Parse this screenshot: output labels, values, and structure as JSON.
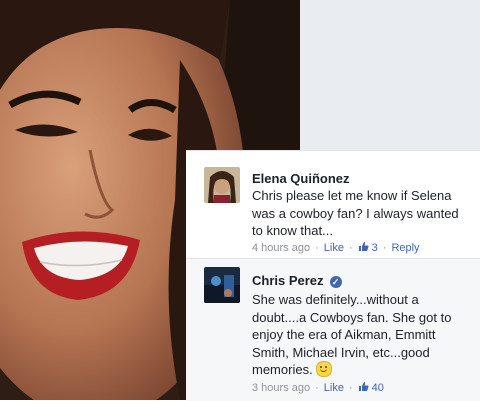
{
  "comments": [
    {
      "author": "Elena Quiñonez",
      "text": "Chris please let me know if Selena was a cowboy fan? I always wanted to know that...",
      "time": "4 hours ago",
      "like_label": "Like",
      "like_count": "3",
      "reply_label": "Reply",
      "verified": false
    },
    {
      "author": "Chris Perez",
      "text": "She was definitely...without a doubt....a Cowboys fan. She got to enjoy the era of Aikman, Emmitt Smith, Michael Irvin, etc...good memories.",
      "time": "3 hours ago",
      "like_label": "Like",
      "like_count": "40",
      "verified": true
    }
  ],
  "icons": {
    "verified": "verified-badge-icon",
    "thumb": "thumbs-up-icon",
    "emoji": "smile-emoji-icon"
  },
  "colors": {
    "link": "#4267b2",
    "meta": "#90949c",
    "text": "#1d2129"
  }
}
